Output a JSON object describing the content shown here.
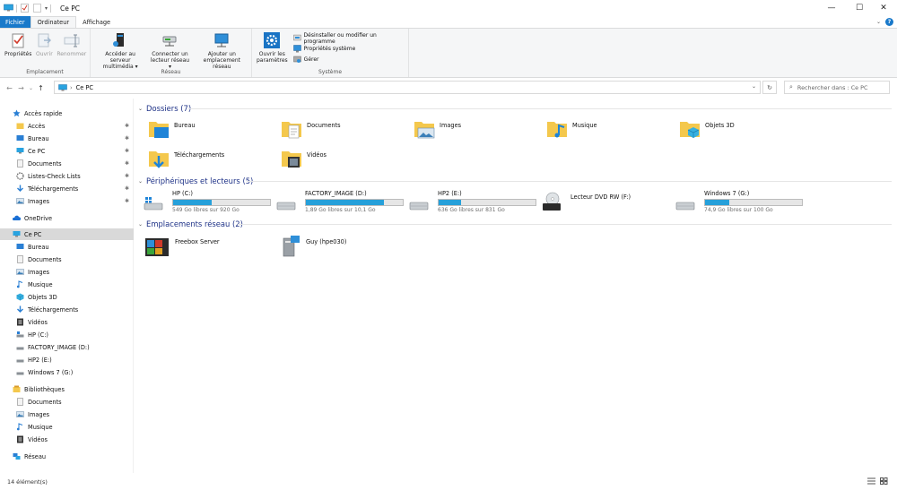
{
  "window": {
    "title": "Ce PC",
    "minimize": "—",
    "maximize": "☐",
    "close": "✕"
  },
  "tabs": [
    {
      "label": "Fichier"
    },
    {
      "label": "Ordinateur"
    },
    {
      "label": "Affichage"
    }
  ],
  "ribbon": {
    "emplacement": {
      "label": "Emplacement",
      "buttons": [
        {
          "label": "Propriétés"
        },
        {
          "label": "Ouvrir"
        },
        {
          "label": "Renommer"
        }
      ]
    },
    "reseau": {
      "label": "Réseau",
      "buttons": [
        {
          "line1": "Accéder au serveur",
          "line2": "multimédia ▾"
        },
        {
          "line1": "Connecter un",
          "line2": "lecteur réseau ▾"
        },
        {
          "line1": "Ajouter un",
          "line2": "emplacement réseau"
        }
      ]
    },
    "systeme": {
      "label": "Système",
      "big": {
        "line1": "Ouvrir les",
        "line2": "paramètres"
      },
      "small": [
        {
          "label": "Désinstaller ou modifier un programme"
        },
        {
          "label": "Propriétés système"
        },
        {
          "label": "Gérer"
        }
      ]
    }
  },
  "address": {
    "path": "Ce PC",
    "search_placeholder": "Rechercher dans : Ce PC"
  },
  "nav": {
    "quick": {
      "label": "Accès rapide",
      "items": [
        {
          "label": "Accès"
        },
        {
          "label": "Bureau"
        },
        {
          "label": "Ce PC"
        },
        {
          "label": "Documents"
        },
        {
          "label": "Listes-Check Lists"
        },
        {
          "label": "Téléchargements"
        },
        {
          "label": "Images"
        }
      ]
    },
    "onedrive": "OneDrive",
    "thispc": {
      "label": "Ce PC",
      "items": [
        {
          "label": "Bureau"
        },
        {
          "label": "Documents"
        },
        {
          "label": "Images"
        },
        {
          "label": "Musique"
        },
        {
          "label": "Objets 3D"
        },
        {
          "label": "Téléchargements"
        },
        {
          "label": "Vidéos"
        },
        {
          "label": "HP (C:)"
        },
        {
          "label": "FACTORY_IMAGE (D:)"
        },
        {
          "label": "HP2 (E:)"
        },
        {
          "label": "Windows 7 (G:)"
        }
      ]
    },
    "libraries": {
      "label": "Bibliothèques",
      "items": [
        {
          "label": "Documents"
        },
        {
          "label": "Images"
        },
        {
          "label": "Musique"
        },
        {
          "label": "Vidéos"
        }
      ]
    },
    "network": "Réseau"
  },
  "groups": {
    "folders": {
      "label": "Dossiers (7)",
      "items": [
        {
          "label": "Bureau"
        },
        {
          "label": "Documents"
        },
        {
          "label": "Images"
        },
        {
          "label": "Musique"
        },
        {
          "label": "Objets 3D"
        },
        {
          "label": "Téléchargements"
        },
        {
          "label": "Vidéos"
        }
      ]
    },
    "drives": {
      "label": "Périphériques et lecteurs (5)",
      "items": [
        {
          "label": "HP (C:)",
          "free": "549 Go libres sur 920 Go",
          "used_fraction": 0.4
        },
        {
          "label": "FACTORY_IMAGE (D:)",
          "free": "1,89 Go libres sur 10,1 Go",
          "used_fraction": 0.81
        },
        {
          "label": "HP2 (E:)",
          "free": "636 Go libres sur 831 Go",
          "used_fraction": 0.23
        },
        {
          "label": "Lecteur DVD RW (F:)",
          "free": ""
        },
        {
          "label": "Windows 7 (G:)",
          "free": "74,9 Go libres sur 100 Go",
          "used_fraction": 0.25
        }
      ]
    },
    "network": {
      "label": "Emplacements réseau (2)",
      "items": [
        {
          "label": "Freebox Server"
        },
        {
          "label": "Guy (hpe030)"
        }
      ]
    }
  },
  "status": {
    "count": "14 élément(s)"
  }
}
